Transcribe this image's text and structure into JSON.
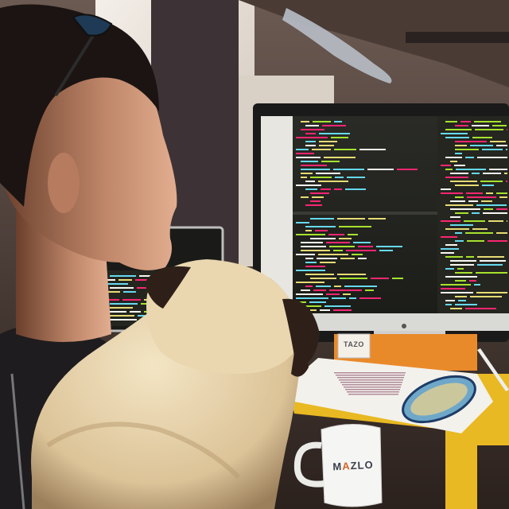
{
  "photo": {
    "mug_brand_left": "M",
    "mug_brand_accent": "A",
    "mug_brand_right": "ZLO",
    "tea_box_label": "TAZO",
    "colors": {
      "editor_bg": "#23241f",
      "keyword": "#f92672",
      "string": "#e6db74",
      "attr": "#a6e22e",
      "desk": "#f2c32c",
      "pug_fur": "#e9d6ae",
      "pug_mask": "#2e2019",
      "mug_accent": "#d2642a"
    }
  }
}
